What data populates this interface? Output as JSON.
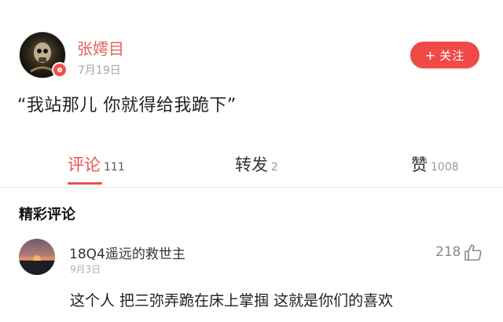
{
  "post": {
    "username": "张嫮目",
    "date": "7月19日",
    "follow_label": "关注",
    "text": "“我站那儿 你就得给我跪下”"
  },
  "tabs": [
    {
      "label": "评论",
      "count": "111",
      "active": true
    },
    {
      "label": "转发",
      "count": "2",
      "active": false
    },
    {
      "label": "赞",
      "count": "1008",
      "active": false
    }
  ],
  "comments_section": {
    "title": "精彩评论",
    "comments": [
      {
        "username": "18Q4遥远的救世主",
        "date": "9月3日",
        "likes": "218",
        "text": "这个人 把三弥弄跪在床上掌掴 这就是你们的喜欢"
      }
    ]
  },
  "colors": {
    "accent": "#e8524f",
    "follow_button": "#f04a47",
    "username": "#e3615a",
    "muted_text": "#a6a6a6"
  },
  "icons": [
    "plus-icon",
    "thumbs-up-icon",
    "verified-badge-icon"
  ]
}
